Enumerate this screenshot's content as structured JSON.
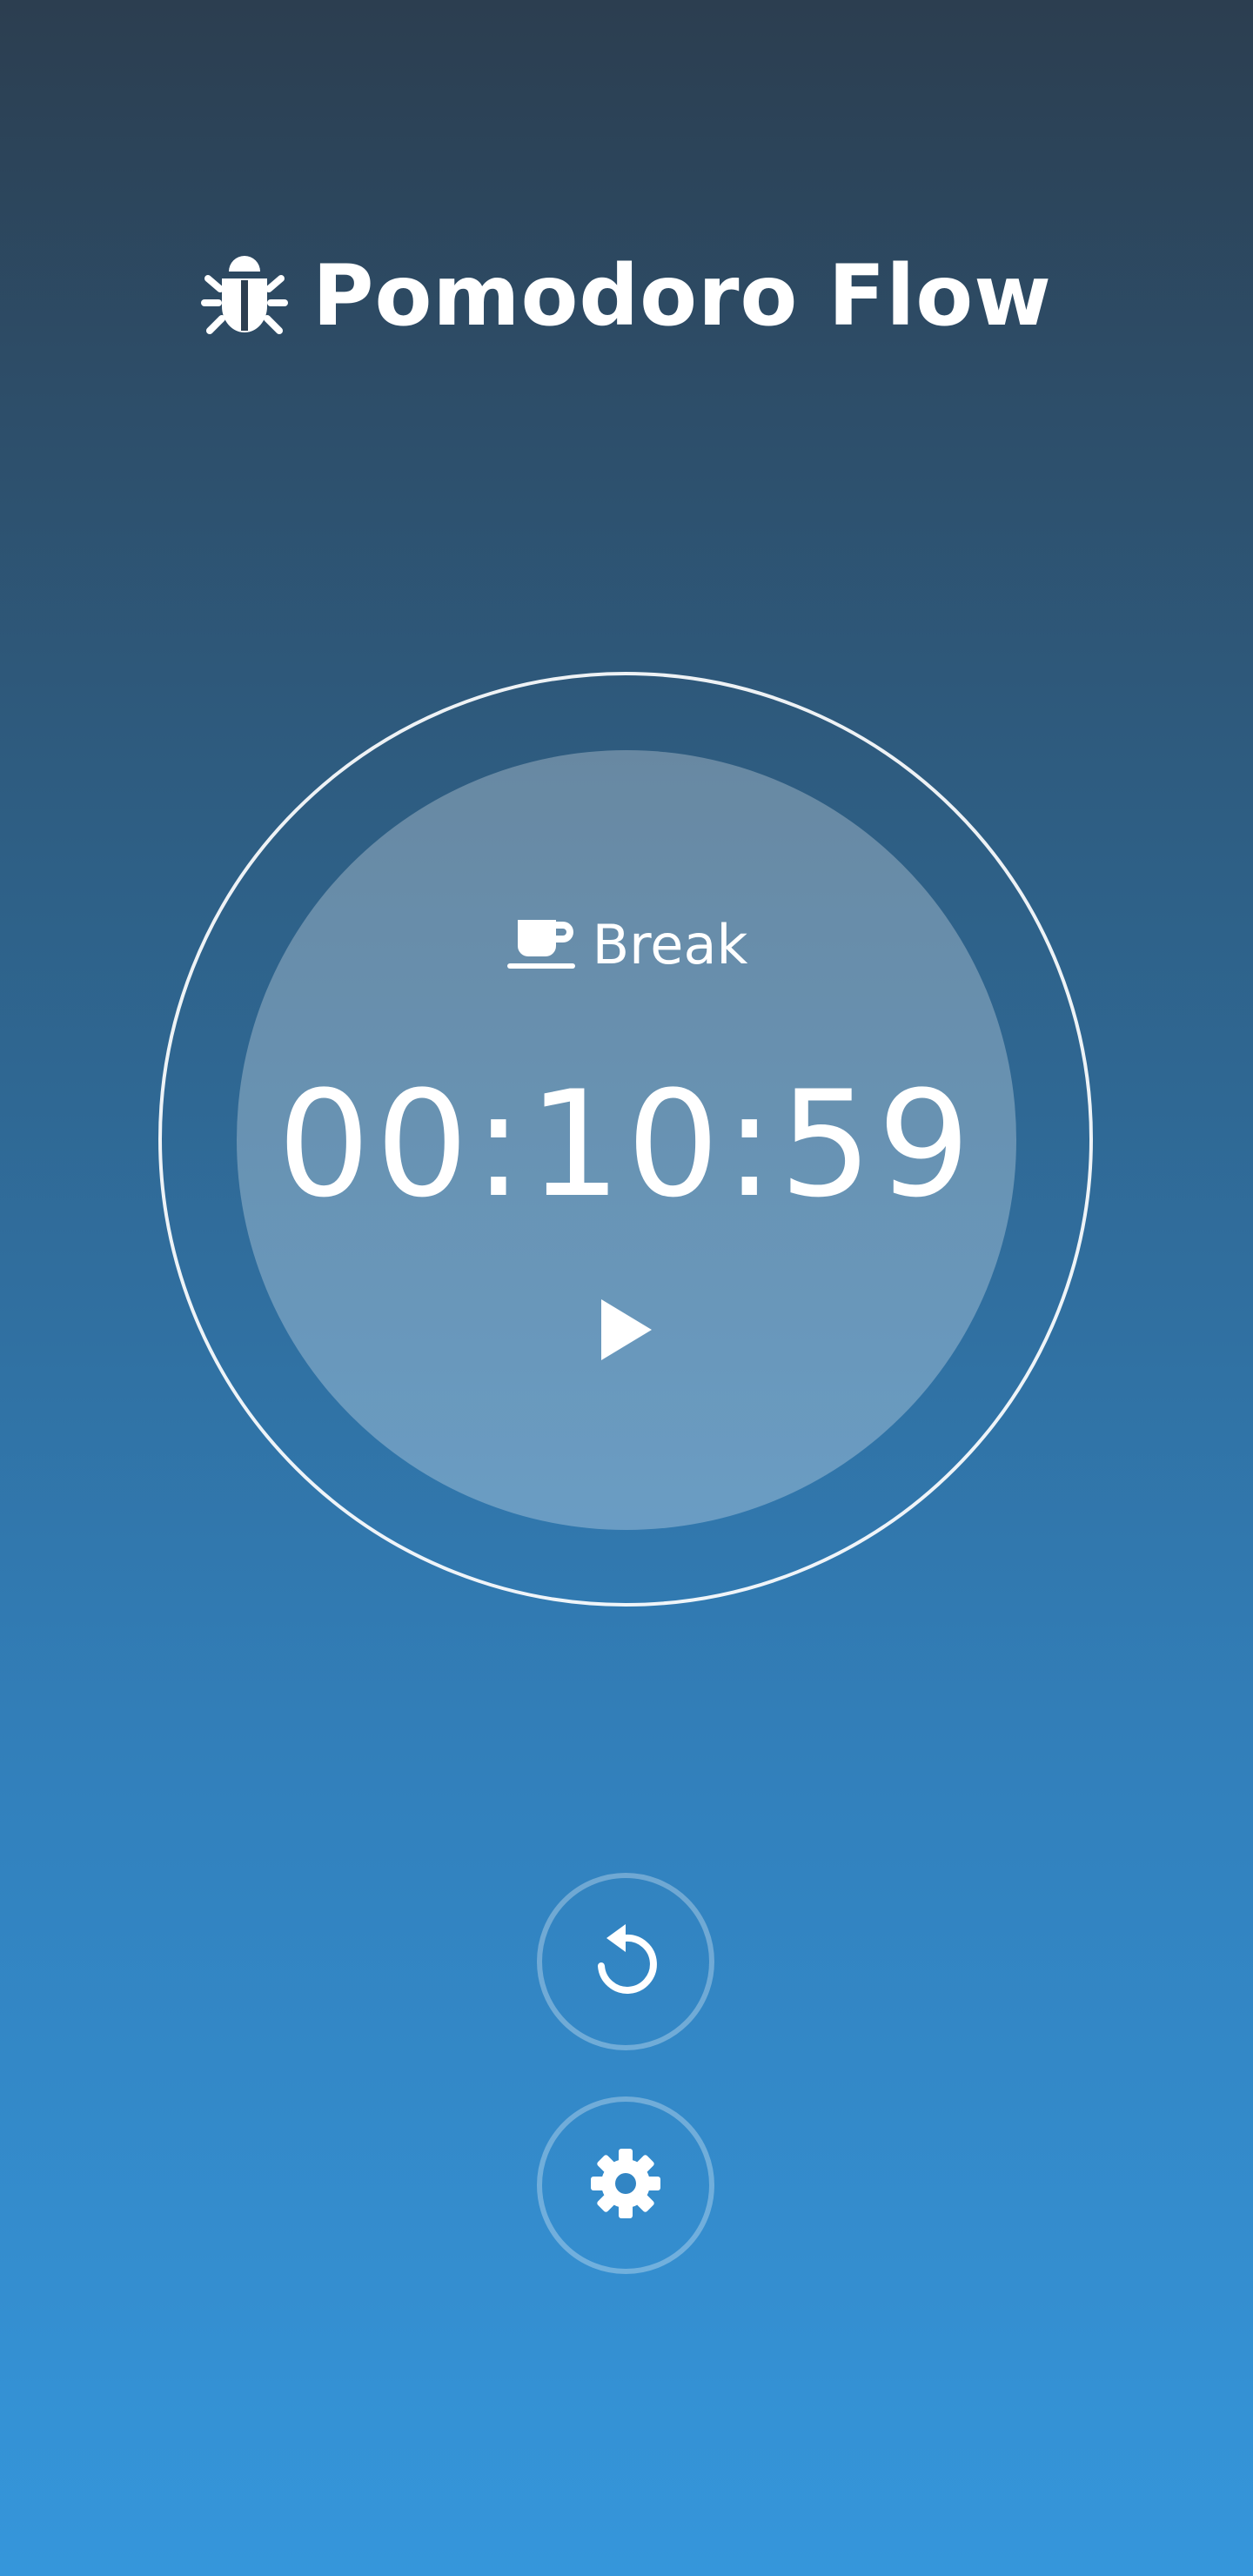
{
  "app": {
    "title": "Pomodoro Flow",
    "logo_icon": "bug-icon"
  },
  "timer": {
    "mode_label": "Break",
    "mode_icon": "coffee-icon",
    "time": "00:10:59",
    "play_icon": "play-icon"
  },
  "controls": {
    "reset_icon": "reset-icon",
    "settings_icon": "gear-icon"
  },
  "colors": {
    "background_top": "#2c3e50",
    "background_bottom": "#3596db",
    "foreground": "#ffffff"
  }
}
